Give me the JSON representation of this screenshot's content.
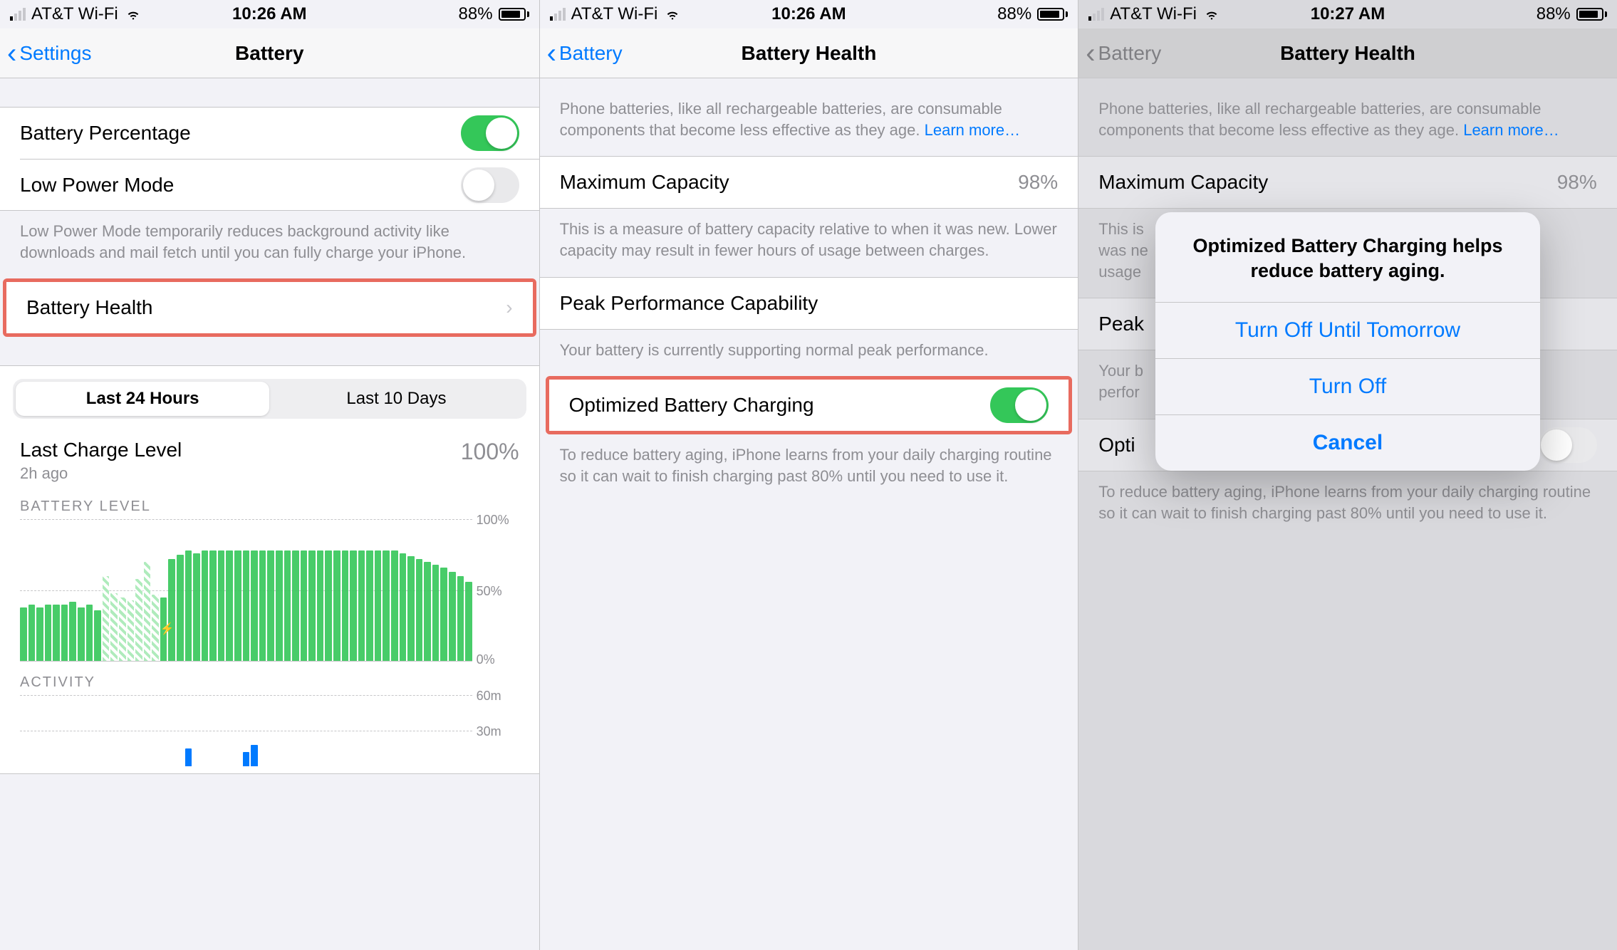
{
  "shared": {
    "carrier": "AT&T Wi-Fi",
    "battery_pct_status": "88%",
    "learn_more": "Learn more…"
  },
  "pane1": {
    "time": "10:26 AM",
    "back": "Settings",
    "title": "Battery",
    "rows": {
      "battery_percentage": "Battery Percentage",
      "low_power_mode": "Low Power Mode",
      "battery_health": "Battery Health"
    },
    "lpm_footer": "Low Power Mode temporarily reduces background activity like downloads and mail fetch until you can fully charge your iPhone.",
    "segmented": {
      "a": "Last 24 Hours",
      "b": "Last 10 Days"
    },
    "last_charge": {
      "title": "Last Charge Level",
      "sub": "2h ago",
      "pct": "100%"
    },
    "chart_labels": {
      "battery_level": "BATTERY LEVEL",
      "activity": "ACTIVITY",
      "y100": "100%",
      "y50": "50%",
      "y0": "0%",
      "a60": "60m",
      "a30": "30m"
    }
  },
  "pane2": {
    "time": "10:26 AM",
    "back": "Battery",
    "title": "Battery Health",
    "intro": "Phone batteries, like all rechargeable batteries, are consumable components that become less effective as they age. ",
    "max_cap": {
      "label": "Maximum Capacity",
      "value": "98%"
    },
    "max_cap_footer": "This is a measure of battery capacity relative to when it was new. Lower capacity may result in fewer hours of usage between charges.",
    "peak": {
      "label": "Peak Performance Capability"
    },
    "peak_footer": "Your battery is currently supporting normal peak performance.",
    "opt": {
      "label": "Optimized Battery Charging"
    },
    "opt_footer": "To reduce battery aging, iPhone learns from your daily charging routine so it can wait to finish charging past 80% until you need to use it."
  },
  "pane3": {
    "time": "10:27 AM",
    "back": "Battery",
    "title": "Battery Health",
    "opt_truncated": "Opti",
    "peak_truncated": "Peak",
    "peak_footer_truncated1": "Your b",
    "peak_footer_truncated2": "perfor",
    "max_footer_l1": "This is",
    "max_footer_l2": "was ne",
    "max_footer_l3": "usage",
    "alert": {
      "title": "Optimized Battery Charging helps reduce battery aging.",
      "btn1": "Turn Off Until Tomorrow",
      "btn2": "Turn Off",
      "btn3": "Cancel"
    }
  },
  "chart_data": {
    "type": "bar",
    "title": "BATTERY LEVEL",
    "ylim": [
      0,
      100
    ],
    "values": [
      38,
      40,
      38,
      40,
      40,
      40,
      42,
      38,
      40,
      36,
      60,
      48,
      45,
      43,
      58,
      70,
      47,
      45,
      72,
      75,
      78,
      76,
      78,
      78,
      78,
      78,
      78,
      78,
      78,
      78,
      78,
      78,
      78,
      78,
      78,
      78,
      78,
      78,
      78,
      78,
      78,
      78,
      78,
      78,
      78,
      78,
      76,
      74,
      72,
      70,
      68,
      66,
      63,
      60,
      56
    ],
    "hatched_indices": [
      10,
      11,
      12,
      13,
      14,
      15,
      16
    ],
    "activity": {
      "ylim": [
        0,
        60
      ],
      "values": [
        0,
        0,
        0,
        0,
        0,
        0,
        0,
        0,
        0,
        0,
        0,
        0,
        0,
        0,
        0,
        0,
        0,
        0,
        0,
        0,
        15,
        0,
        0,
        0,
        0,
        0,
        0,
        12,
        18,
        0,
        0,
        0,
        0,
        0,
        0,
        0,
        0,
        0,
        0,
        0,
        0,
        0,
        0,
        0,
        0,
        0,
        0,
        0,
        0,
        0,
        0,
        0,
        0,
        0,
        0
      ]
    }
  }
}
